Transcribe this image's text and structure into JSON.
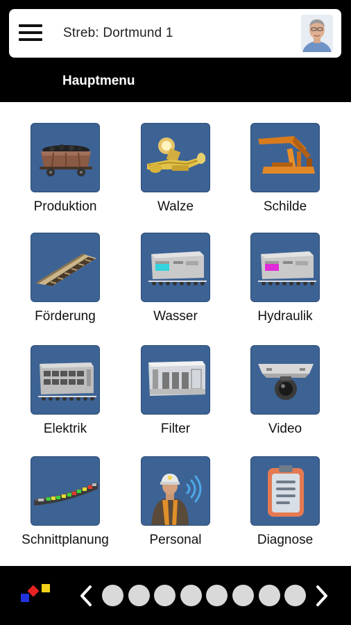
{
  "header": {
    "title": "Streb: Dortmund 1",
    "subtitle": "Hauptmenu",
    "menu_icon": "hamburger-icon",
    "avatar": "user-avatar"
  },
  "menu": {
    "items": [
      {
        "label": "Produktion",
        "icon": "coal-wagon-icon"
      },
      {
        "label": "Walze",
        "icon": "shearer-icon"
      },
      {
        "label": "Schilde",
        "icon": "shield-support-icon"
      },
      {
        "label": "Förderung",
        "icon": "conveyor-icon"
      },
      {
        "label": "Wasser",
        "icon": "water-unit-icon"
      },
      {
        "label": "Hydraulik",
        "icon": "hydraulic-unit-icon"
      },
      {
        "label": "Elektrik",
        "icon": "electric-cabinet-icon"
      },
      {
        "label": "Filter",
        "icon": "filter-unit-icon"
      },
      {
        "label": "Video",
        "icon": "camera-icon"
      },
      {
        "label": "Schnittplanung",
        "icon": "cut-planning-icon"
      },
      {
        "label": "Personal",
        "icon": "miner-signal-icon"
      },
      {
        "label": "Diagnose",
        "icon": "clipboard-icon"
      }
    ]
  },
  "footer": {
    "logo": "colored-squares-logo",
    "prev_icon": "chevron-left-icon",
    "next_icon": "chevron-right-icon",
    "page_dots": 8
  },
  "colors": {
    "header_bg": "#000000",
    "tile_bg": "#3d6395",
    "dot": "#d9d9d9"
  }
}
